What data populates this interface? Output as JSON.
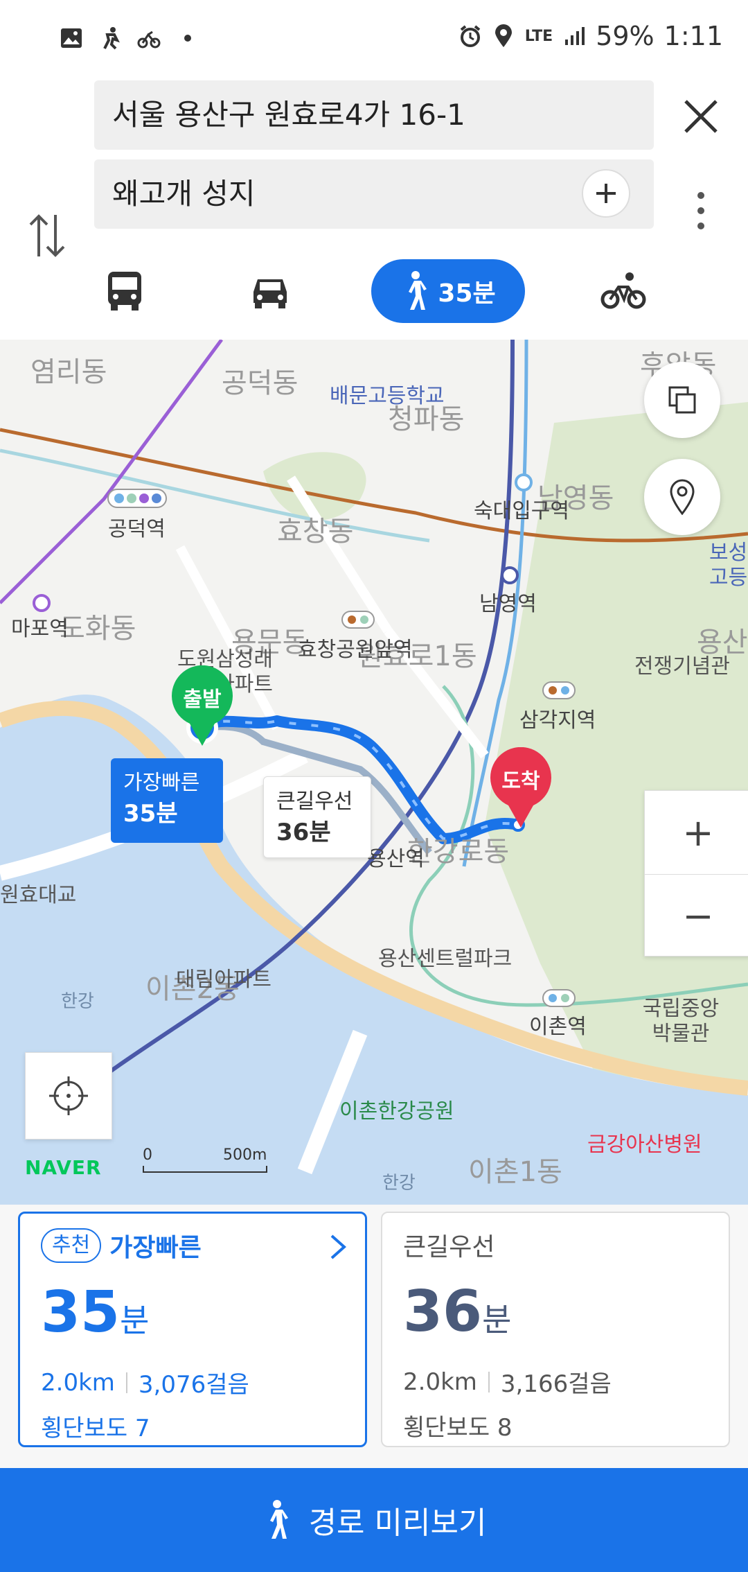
{
  "status_bar": {
    "network": "LTE",
    "battery": "59%",
    "time": "1:11",
    "left_icons": [
      "gallery-icon",
      "run-icon",
      "bike-activity-icon",
      "dot-icon"
    ],
    "right_icons": [
      "alarm-icon",
      "location-icon",
      "signal-icon"
    ]
  },
  "search": {
    "from": "서울 용산구 원효로4가 16-1",
    "to": "왜고개 성지"
  },
  "modes": {
    "walk_time": "35분",
    "selected": "walk"
  },
  "map": {
    "districts": [
      "염리동",
      "공덕동",
      "청파동",
      "효창동",
      "도화동",
      "용문동",
      "원효로1동",
      "한강로동",
      "이촌2동",
      "이촌1동",
      "후암동",
      "남영동",
      "용산"
    ],
    "stations": [
      "공덕역",
      "마포역",
      "숙대입구역",
      "남영역",
      "효창공원앞역",
      "삼각지역",
      "용산역",
      "이촌역"
    ],
    "pois": [
      "배문고등학교",
      "도원삼성래미안아파트",
      "전쟁기념관",
      "용산센트럴파크",
      "대림아파트",
      "국립중앙박물관",
      "이촌한강공원",
      "금강아산병원",
      "원효대교",
      "한강",
      "한강",
      "보성고등",
      "원"
    ],
    "start_label": "출발",
    "end_label": "도착",
    "fast_route": {
      "name": "가장빠른",
      "time": "35분"
    },
    "alt_route": {
      "name": "큰길우선",
      "time": "36분"
    },
    "brand": "NAVER",
    "scale_start": "0",
    "scale_end": "500m",
    "zoom_in": "+",
    "zoom_out": "−"
  },
  "cards": [
    {
      "badge": "추천",
      "name": "가장빠른",
      "minutes": "35",
      "unit": "분",
      "distance": "2.0km",
      "steps": "3,076걸음",
      "crosswalk": "횡단보도 7"
    },
    {
      "name": "큰길우선",
      "minutes": "36",
      "unit": "분",
      "distance": "2.0km",
      "steps": "3,166걸음",
      "crosswalk": "횡단보도 8"
    }
  ],
  "preview_button": "경로 미리보기",
  "colors": {
    "accent": "#1a73e8",
    "start_pin": "#14b85a",
    "end_pin": "#e8344e",
    "naver": "#03c75a"
  }
}
